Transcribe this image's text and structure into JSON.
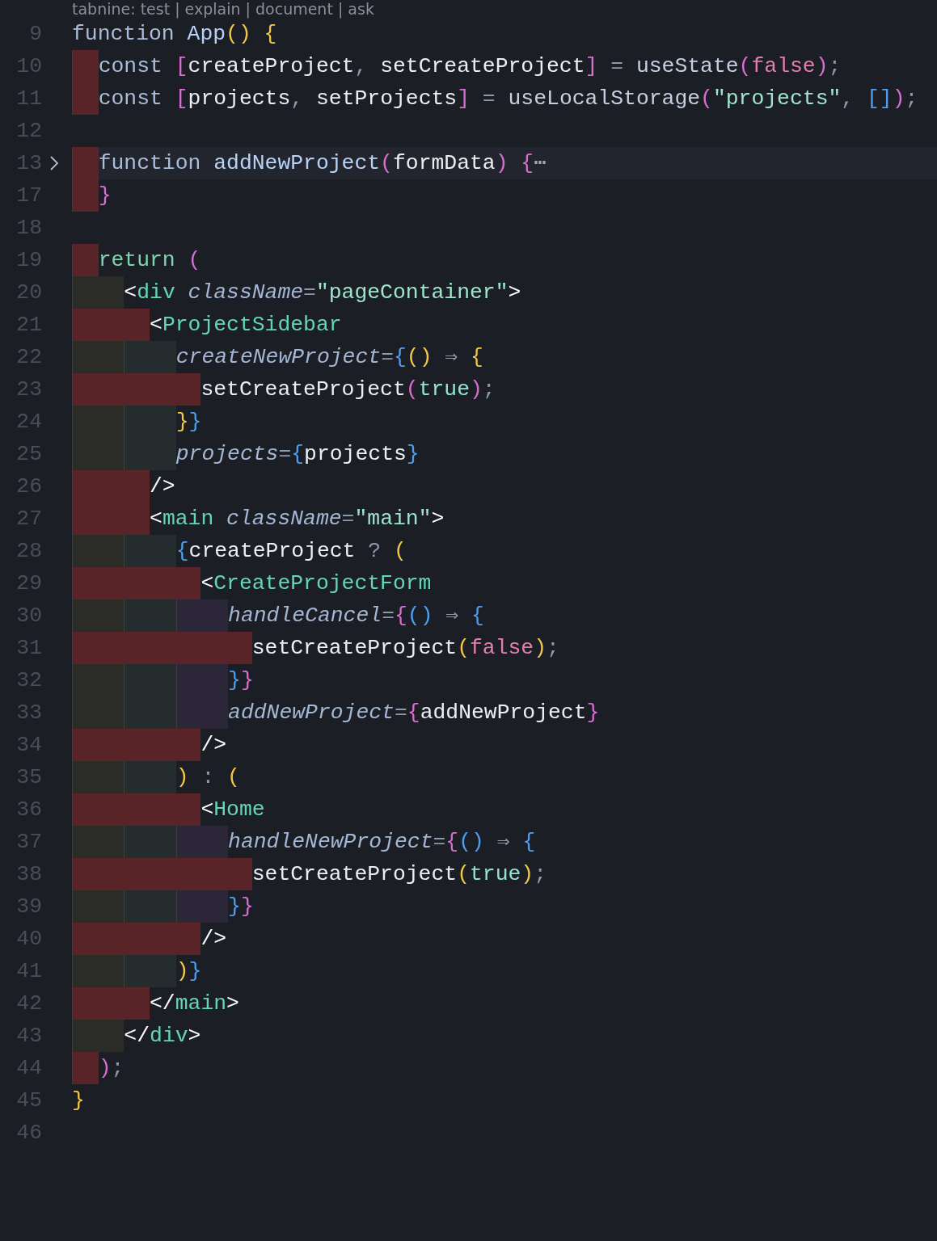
{
  "codelens": "tabnine: test | explain | document | ask",
  "lines": [
    {
      "number": "9",
      "highlighted": false,
      "folded": false,
      "tokens": [
        {
          "kind": "kw",
          "text": "function"
        },
        {
          "kind": "fname",
          "text": " App"
        },
        {
          "kind": "p1",
          "text": "()"
        },
        {
          "kind": "p1",
          "text": " {"
        }
      ]
    },
    {
      "number": "10",
      "highlighted": false,
      "folded": false,
      "tokens": [
        {
          "kind": "kw",
          "text": "  const "
        },
        {
          "kind": "p2",
          "text": "["
        },
        {
          "kind": "id",
          "text": "createProject"
        },
        {
          "kind": "op",
          "text": ", "
        },
        {
          "kind": "id",
          "text": "setCreateProject"
        },
        {
          "kind": "p2",
          "text": "]"
        },
        {
          "kind": "op",
          "text": " = "
        },
        {
          "kind": "call",
          "text": "useState"
        },
        {
          "kind": "p2",
          "text": "("
        },
        {
          "kind": "bfalse",
          "text": "false"
        },
        {
          "kind": "p2",
          "text": ")"
        },
        {
          "kind": "op",
          "text": ";"
        }
      ]
    },
    {
      "number": "11",
      "highlighted": false,
      "folded": false,
      "tokens": [
        {
          "kind": "kw",
          "text": "  const "
        },
        {
          "kind": "p2",
          "text": "["
        },
        {
          "kind": "id",
          "text": "projects"
        },
        {
          "kind": "op",
          "text": ", "
        },
        {
          "kind": "id",
          "text": "setProjects"
        },
        {
          "kind": "p2",
          "text": "]"
        },
        {
          "kind": "op",
          "text": " = "
        },
        {
          "kind": "call",
          "text": "useLocalStorage"
        },
        {
          "kind": "p2",
          "text": "("
        },
        {
          "kind": "str",
          "text": "\"projects\""
        },
        {
          "kind": "op",
          "text": ", "
        },
        {
          "kind": "p3",
          "text": "[]"
        },
        {
          "kind": "p2",
          "text": ")"
        },
        {
          "kind": "op",
          "text": ";"
        }
      ]
    },
    {
      "number": "12",
      "highlighted": false,
      "folded": false
    },
    {
      "number": "13",
      "highlighted": true,
      "folded": true,
      "tokens": [
        {
          "kind": "kw",
          "text": "  function"
        },
        {
          "kind": "fname",
          "text": " addNewProject"
        },
        {
          "kind": "p2",
          "text": "("
        },
        {
          "kind": "id",
          "text": "formData"
        },
        {
          "kind": "p2",
          "text": ")"
        },
        {
          "kind": "p2",
          "text": " {"
        },
        {
          "kind": "ellipsis",
          "text": "⋯"
        }
      ]
    },
    {
      "number": "17",
      "highlighted": false,
      "folded": false,
      "tokens": [
        {
          "kind": "p2",
          "text": "  }"
        }
      ]
    },
    {
      "number": "18",
      "highlighted": false,
      "folded": false
    },
    {
      "number": "19",
      "highlighted": false,
      "folded": false,
      "tokens": [
        {
          "kind": "ret",
          "text": "  return"
        },
        {
          "kind": "p2",
          "text": " ("
        }
      ]
    },
    {
      "number": "20",
      "highlighted": false,
      "folded": false,
      "tokens": [
        {
          "kind": "punct",
          "text": "    <"
        },
        {
          "kind": "tag",
          "text": "div"
        },
        {
          "kind": "attr",
          "text": " className"
        },
        {
          "kind": "op",
          "text": "="
        },
        {
          "kind": "str",
          "text": "\"pageContainer\""
        },
        {
          "kind": "punct",
          "text": ">"
        }
      ]
    },
    {
      "number": "21",
      "highlighted": false,
      "folded": false,
      "tokens": [
        {
          "kind": "punct",
          "text": "      <"
        },
        {
          "kind": "tag",
          "text": "ProjectSidebar"
        }
      ]
    },
    {
      "number": "22",
      "highlighted": false,
      "folded": false,
      "tokens": [
        {
          "kind": "attr",
          "text": "        createNewProject"
        },
        {
          "kind": "op",
          "text": "="
        },
        {
          "kind": "p3",
          "text": "{"
        },
        {
          "kind": "p1",
          "text": "()"
        },
        {
          "kind": "op",
          "text": " ⇒ "
        },
        {
          "kind": "p1",
          "text": "{"
        }
      ]
    },
    {
      "number": "23",
      "highlighted": false,
      "folded": false,
      "tokens": [
        {
          "kind": "id",
          "text": "          setCreateProject"
        },
        {
          "kind": "p2",
          "text": "("
        },
        {
          "kind": "btrue",
          "text": "true"
        },
        {
          "kind": "p2",
          "text": ")"
        },
        {
          "kind": "op",
          "text": ";"
        }
      ]
    },
    {
      "number": "24",
      "highlighted": false,
      "folded": false,
      "tokens": [
        {
          "kind": "p1",
          "text": "        }"
        },
        {
          "kind": "p3",
          "text": "}"
        }
      ]
    },
    {
      "number": "25",
      "highlighted": false,
      "folded": false,
      "tokens": [
        {
          "kind": "attr",
          "text": "        projects"
        },
        {
          "kind": "op",
          "text": "="
        },
        {
          "kind": "p3",
          "text": "{"
        },
        {
          "kind": "id",
          "text": "projects"
        },
        {
          "kind": "p3",
          "text": "}"
        }
      ]
    },
    {
      "number": "26",
      "highlighted": false,
      "folded": false,
      "tokens": [
        {
          "kind": "punct",
          "text": "      />"
        }
      ]
    },
    {
      "number": "27",
      "highlighted": false,
      "folded": false,
      "tokens": [
        {
          "kind": "punct",
          "text": "      <"
        },
        {
          "kind": "tag",
          "text": "main"
        },
        {
          "kind": "attr",
          "text": " className"
        },
        {
          "kind": "op",
          "text": "="
        },
        {
          "kind": "str",
          "text": "\"main\""
        },
        {
          "kind": "punct",
          "text": ">"
        }
      ]
    },
    {
      "number": "28",
      "highlighted": false,
      "folded": false,
      "tokens": [
        {
          "kind": "p3",
          "text": "        {"
        },
        {
          "kind": "id",
          "text": "createProject"
        },
        {
          "kind": "op",
          "text": " ? "
        },
        {
          "kind": "p1",
          "text": "("
        }
      ]
    },
    {
      "number": "29",
      "highlighted": false,
      "folded": false,
      "tokens": [
        {
          "kind": "punct",
          "text": "          <"
        },
        {
          "kind": "tag",
          "text": "CreateProjectForm"
        }
      ]
    },
    {
      "number": "30",
      "highlighted": false,
      "folded": false,
      "tokens": [
        {
          "kind": "attr",
          "text": "            handleCancel"
        },
        {
          "kind": "op",
          "text": "="
        },
        {
          "kind": "p2",
          "text": "{"
        },
        {
          "kind": "p3",
          "text": "()"
        },
        {
          "kind": "op",
          "text": " ⇒ "
        },
        {
          "kind": "p3",
          "text": "{"
        }
      ]
    },
    {
      "number": "31",
      "highlighted": false,
      "folded": false,
      "tokens": [
        {
          "kind": "id",
          "text": "              setCreateProject"
        },
        {
          "kind": "p1",
          "text": "("
        },
        {
          "kind": "bfalse",
          "text": "false"
        },
        {
          "kind": "p1",
          "text": ")"
        },
        {
          "kind": "op",
          "text": ";"
        }
      ]
    },
    {
      "number": "32",
      "highlighted": false,
      "folded": false,
      "tokens": [
        {
          "kind": "p3",
          "text": "            }"
        },
        {
          "kind": "p2",
          "text": "}"
        }
      ]
    },
    {
      "number": "33",
      "highlighted": false,
      "folded": false,
      "tokens": [
        {
          "kind": "attr",
          "text": "            addNewProject"
        },
        {
          "kind": "op",
          "text": "="
        },
        {
          "kind": "p2",
          "text": "{"
        },
        {
          "kind": "id",
          "text": "addNewProject"
        },
        {
          "kind": "p2",
          "text": "}"
        }
      ]
    },
    {
      "number": "34",
      "highlighted": false,
      "folded": false,
      "tokens": [
        {
          "kind": "punct",
          "text": "          />"
        }
      ]
    },
    {
      "number": "35",
      "highlighted": false,
      "folded": false,
      "tokens": [
        {
          "kind": "p1",
          "text": "        )"
        },
        {
          "kind": "op",
          "text": " : "
        },
        {
          "kind": "p1",
          "text": "("
        }
      ]
    },
    {
      "number": "36",
      "highlighted": false,
      "folded": false,
      "tokens": [
        {
          "kind": "punct",
          "text": "          <"
        },
        {
          "kind": "tag",
          "text": "Home"
        }
      ]
    },
    {
      "number": "37",
      "highlighted": false,
      "folded": false,
      "tokens": [
        {
          "kind": "attr",
          "text": "            handleNewProject"
        },
        {
          "kind": "op",
          "text": "="
        },
        {
          "kind": "p2",
          "text": "{"
        },
        {
          "kind": "p3",
          "text": "()"
        },
        {
          "kind": "op",
          "text": " ⇒ "
        },
        {
          "kind": "p3",
          "text": "{"
        }
      ]
    },
    {
      "number": "38",
      "highlighted": false,
      "folded": false,
      "tokens": [
        {
          "kind": "id",
          "text": "              setCreateProject"
        },
        {
          "kind": "p1",
          "text": "("
        },
        {
          "kind": "btrue",
          "text": "true"
        },
        {
          "kind": "p1",
          "text": ")"
        },
        {
          "kind": "op",
          "text": ";"
        }
      ]
    },
    {
      "number": "39",
      "highlighted": false,
      "folded": false,
      "tokens": [
        {
          "kind": "p3",
          "text": "            }"
        },
        {
          "kind": "p2",
          "text": "}"
        }
      ]
    },
    {
      "number": "40",
      "highlighted": false,
      "folded": false,
      "tokens": [
        {
          "kind": "punct",
          "text": "          />"
        }
      ]
    },
    {
      "number": "41",
      "highlighted": false,
      "folded": false,
      "tokens": [
        {
          "kind": "p1",
          "text": "        )"
        },
        {
          "kind": "p3",
          "text": "}"
        }
      ]
    },
    {
      "number": "42",
      "highlighted": false,
      "folded": false,
      "tokens": [
        {
          "kind": "punct",
          "text": "      </"
        },
        {
          "kind": "tag",
          "text": "main"
        },
        {
          "kind": "punct",
          "text": ">"
        }
      ]
    },
    {
      "number": "43",
      "highlighted": false,
      "folded": false,
      "tokens": [
        {
          "kind": "punct",
          "text": "    </"
        },
        {
          "kind": "tag",
          "text": "div"
        },
        {
          "kind": "punct",
          "text": ">"
        }
      ]
    },
    {
      "number": "44",
      "highlighted": false,
      "folded": false,
      "tokens": [
        {
          "kind": "p2",
          "text": "  )"
        },
        {
          "kind": "op",
          "text": ";"
        }
      ]
    },
    {
      "number": "45",
      "highlighted": false,
      "folded": false,
      "tokens": [
        {
          "kind": "p1",
          "text": "}"
        }
      ]
    },
    {
      "number": "46",
      "highlighted": false,
      "folded": false
    }
  ]
}
